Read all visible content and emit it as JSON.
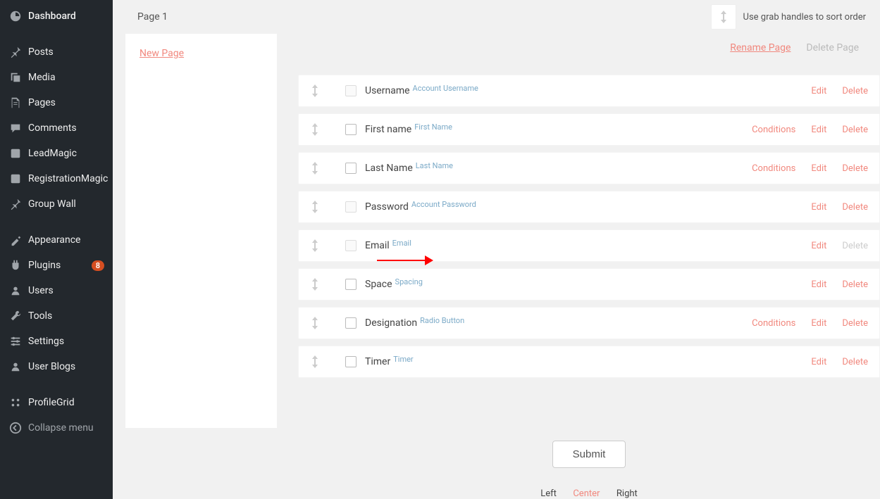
{
  "sidebar": {
    "items": [
      {
        "label": "Dashboard",
        "icon": "dashboard"
      },
      {
        "sep": true
      },
      {
        "label": "Posts",
        "icon": "pin"
      },
      {
        "label": "Media",
        "icon": "media"
      },
      {
        "label": "Pages",
        "icon": "pages"
      },
      {
        "label": "Comments",
        "icon": "comments"
      },
      {
        "label": "LeadMagic",
        "icon": "generic"
      },
      {
        "label": "RegistrationMagic",
        "icon": "generic"
      },
      {
        "label": "Group Wall",
        "icon": "pin"
      },
      {
        "sep": true
      },
      {
        "label": "Appearance",
        "icon": "appearance"
      },
      {
        "label": "Plugins",
        "icon": "plugins",
        "badge": "8"
      },
      {
        "label": "Users",
        "icon": "users"
      },
      {
        "label": "Tools",
        "icon": "tools"
      },
      {
        "label": "Settings",
        "icon": "settings"
      },
      {
        "label": "User Blogs",
        "icon": "users"
      },
      {
        "sep": true
      },
      {
        "label": "ProfileGrid",
        "icon": "grid"
      },
      {
        "label": "Collapse menu",
        "icon": "collapse",
        "collapse": true
      }
    ]
  },
  "topbar": {
    "page_title": "Page 1",
    "hint": "Use grab handles to sort order"
  },
  "pages_panel": {
    "new_page": "New Page"
  },
  "page_actions": {
    "rename": "Rename Page",
    "delete": "Delete Page"
  },
  "fields": [
    {
      "name": "Username",
      "type": "Account Username",
      "chk_disabled": true,
      "actions": [
        "Edit",
        "Delete"
      ]
    },
    {
      "name": "First name",
      "type": "First Name",
      "chk_disabled": false,
      "actions": [
        "Conditions",
        "Edit",
        "Delete"
      ]
    },
    {
      "name": "Last Name",
      "type": "Last Name",
      "chk_disabled": false,
      "actions": [
        "Conditions",
        "Edit",
        "Delete"
      ]
    },
    {
      "name": "Password",
      "type": "Account Password",
      "chk_disabled": true,
      "actions": [
        "Edit",
        "Delete"
      ]
    },
    {
      "name": "Email",
      "type": "Email",
      "chk_disabled": true,
      "actions": [
        "Edit",
        "Delete"
      ],
      "delete_disabled": true
    },
    {
      "name": "Space",
      "type": "Spacing",
      "chk_disabled": false,
      "actions": [
        "Edit",
        "Delete"
      ]
    },
    {
      "name": "Designation",
      "type": "Radio Button",
      "chk_disabled": false,
      "actions": [
        "Conditions",
        "Edit",
        "Delete"
      ]
    },
    {
      "name": "Timer",
      "type": "Timer",
      "chk_disabled": false,
      "actions": [
        "Edit",
        "Delete"
      ]
    }
  ],
  "submit": {
    "label": "Submit"
  },
  "align": {
    "left": "Left",
    "center": "Center",
    "right": "Right"
  }
}
